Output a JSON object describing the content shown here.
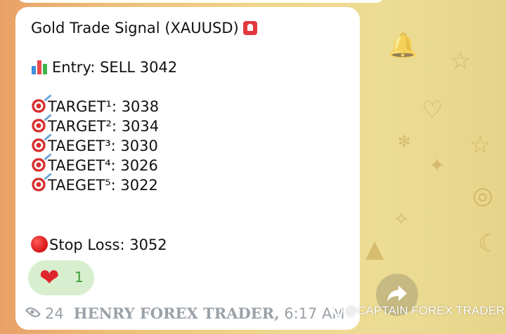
{
  "message": {
    "title": "Gold Trade Signal (XAUUSD)",
    "title_emoji": "rotating-light-icon",
    "entry": "Entry: SELL 3042",
    "entry_emoji": "bar-chart-icon",
    "targets": [
      "TARGET¹: 3038",
      "TARGET²: 3034",
      "TAEGET³: 3030",
      "TAEGET⁴: 3026",
      "TAEGET⁵: 3022"
    ],
    "target_emoji": "direct-hit-icon",
    "stop_loss": "Stop Loss: 3052",
    "stop_emoji": "red-circle-icon"
  },
  "reaction": {
    "emoji": "❤",
    "count": "1"
  },
  "footer": {
    "views": "24",
    "author": "HENRY FOREX TRADER,",
    "time": "6:17 AM"
  },
  "watermark": {
    "text": "@CAPTAIN FOREX TRADER"
  },
  "colors": {
    "bubble": "#ffffff",
    "reaction_bg": "#d8efcf",
    "reaction_count": "#3a9d3a",
    "meta_text": "#9aa1a8",
    "wallpaper": "#efd58a"
  }
}
